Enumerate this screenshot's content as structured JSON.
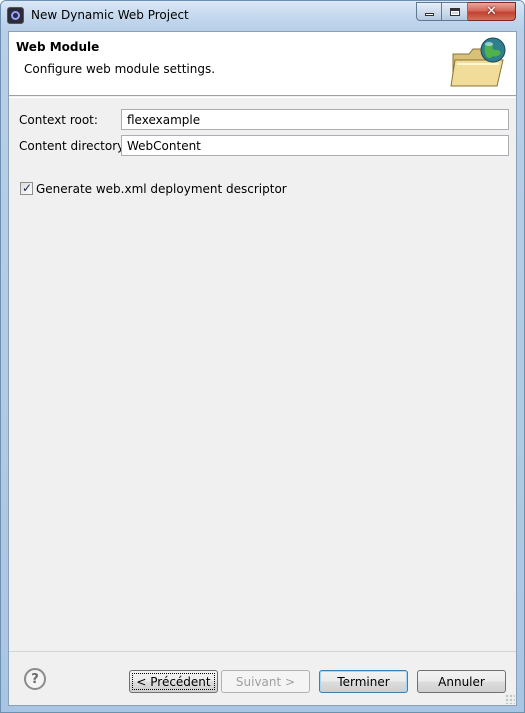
{
  "window": {
    "title": "New Dynamic Web Project",
    "icon": "eclipse-icon"
  },
  "header": {
    "title": "Web Module",
    "description": "Configure web module settings.",
    "icon": "web-folder-icon"
  },
  "form": {
    "context_root": {
      "label": "Context root:",
      "value": "flexexample"
    },
    "content_directory": {
      "label": "Content directory:",
      "value": "WebContent"
    }
  },
  "options": {
    "generate_web_xml": {
      "label": "Generate web.xml deployment descriptor",
      "checked": true
    }
  },
  "buttons": {
    "back": "< Précédent",
    "next": "Suivant >",
    "finish": "Terminer",
    "cancel": "Annuler",
    "help": "?"
  },
  "colors": {
    "close_button": "#c2422f",
    "default_button_border": "#3c7fb1",
    "dialog_background": "#f0f0f0"
  }
}
